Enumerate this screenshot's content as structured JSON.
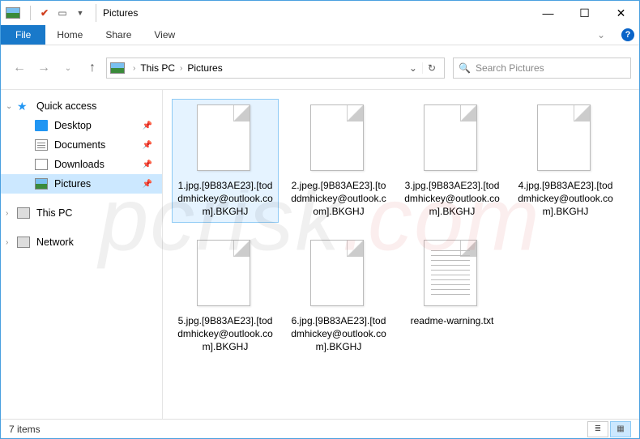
{
  "window": {
    "title": "Pictures"
  },
  "ribbon": {
    "file": "File",
    "tabs": [
      "Home",
      "Share",
      "View"
    ]
  },
  "breadcrumb": {
    "segments": [
      "This PC",
      "Pictures"
    ]
  },
  "search": {
    "placeholder": "Search Pictures"
  },
  "sidebar": {
    "quick_access": "Quick access",
    "items": [
      {
        "label": "Desktop"
      },
      {
        "label": "Documents"
      },
      {
        "label": "Downloads"
      },
      {
        "label": "Pictures"
      }
    ],
    "this_pc": "This PC",
    "network": "Network"
  },
  "files": [
    {
      "name": "1.jpg.[9B83AE23].[toddmhickey@outlook.com].BKGHJ",
      "icon": "blank",
      "selected": true
    },
    {
      "name": "2.jpeg.[9B83AE23].[toddmhickey@outlook.com].BKGHJ",
      "icon": "blank",
      "selected": false
    },
    {
      "name": "3.jpg.[9B83AE23].[toddmhickey@outlook.com].BKGHJ",
      "icon": "blank",
      "selected": false
    },
    {
      "name": "4.jpg.[9B83AE23].[toddmhickey@outlook.com].BKGHJ",
      "icon": "blank",
      "selected": false
    },
    {
      "name": "5.jpg.[9B83AE23].[toddmhickey@outlook.com].BKGHJ",
      "icon": "blank",
      "selected": false
    },
    {
      "name": "6.jpg.[9B83AE23].[toddmhickey@outlook.com].BKGHJ",
      "icon": "blank",
      "selected": false
    },
    {
      "name": "readme-warning.txt",
      "icon": "text",
      "selected": false
    }
  ],
  "status": {
    "count_label": "7 items"
  },
  "watermark": {
    "prefix": "pcrisk",
    "suffix": ".com"
  }
}
